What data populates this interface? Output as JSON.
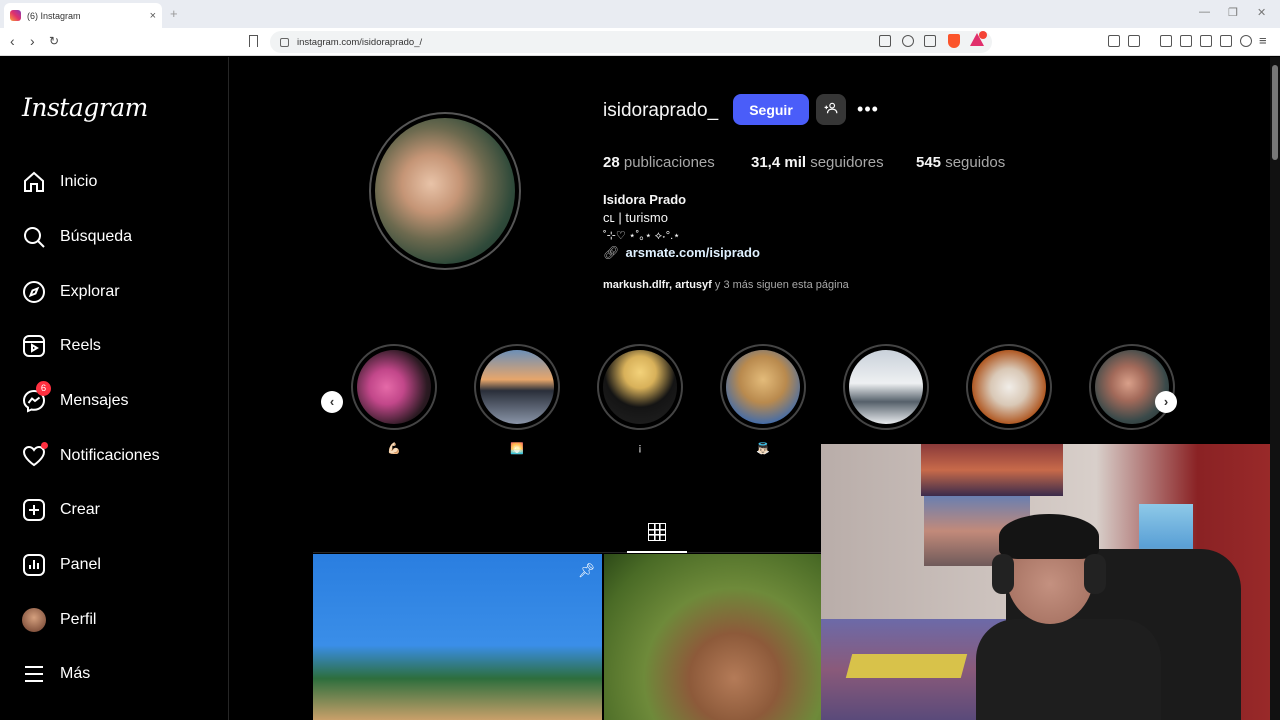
{
  "browser": {
    "tab_title": "(6) Instagram",
    "tab_close": "×",
    "new_tab": "+",
    "url": "instagram.com/isidoraprado_/",
    "window_controls": [
      "—",
      "❐",
      "✕"
    ]
  },
  "sidebar": {
    "logo": "Instagram",
    "items": [
      {
        "label": "Inicio",
        "icon": "home-icon"
      },
      {
        "label": "Búsqueda",
        "icon": "search-icon"
      },
      {
        "label": "Explorar",
        "icon": "compass-icon"
      },
      {
        "label": "Reels",
        "icon": "reels-icon"
      },
      {
        "label": "Mensajes",
        "icon": "messenger-icon",
        "badge": "6"
      },
      {
        "label": "Notificaciones",
        "icon": "heart-icon"
      },
      {
        "label": "Crear",
        "icon": "plus-square-icon"
      },
      {
        "label": "Panel",
        "icon": "dashboard-icon"
      },
      {
        "label": "Perfil",
        "icon": "avatar"
      },
      {
        "label": "Más",
        "icon": "menu-icon"
      }
    ]
  },
  "profile": {
    "username": "isidoraprado_",
    "follow_label": "Seguir",
    "more_label": "•••",
    "posts_count": "28",
    "posts_label": "publicaciones",
    "followers_count": "31,4 mil",
    "followers_label": "seguidores",
    "following_count": "545",
    "following_label": "seguidos",
    "full_name": "Isidora Prado",
    "bio_line1": "ᴄʟ | turismo",
    "bio_line2": "˚⊹♡ ⋆˚｡⋆ ⟡˖°.⋆",
    "link": "arsmate.com/isiprado",
    "followed_by_users": "markush.dlfr, artusyf",
    "followed_by_rest": " y 3 más siguen esta página"
  },
  "highlights": [
    {
      "label": "💪🏻"
    },
    {
      "label": "🌅"
    },
    {
      "label": "¡"
    },
    {
      "label": "👼🏻"
    },
    {
      "label": ""
    },
    {
      "label": ""
    },
    {
      "label": ""
    }
  ],
  "colors": {
    "accent": "#4a5df9",
    "badge": "#ff3040",
    "background": "#000000"
  }
}
